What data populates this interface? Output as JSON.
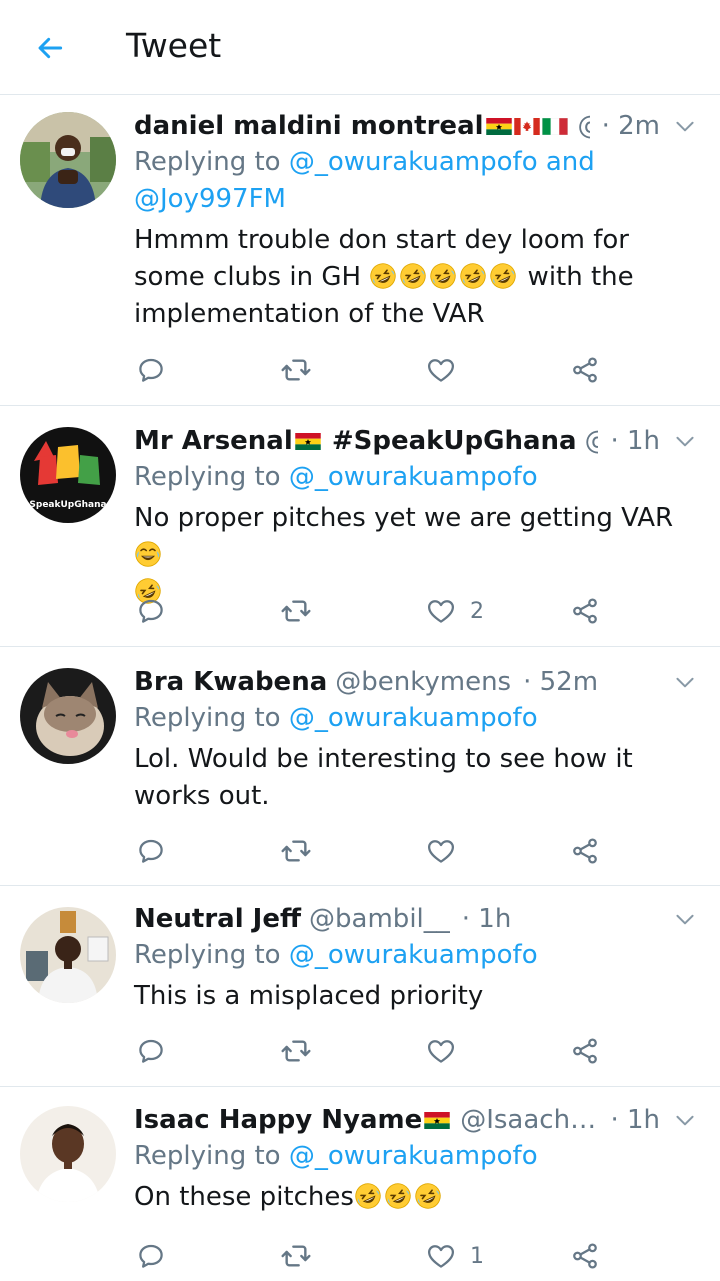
{
  "header": {
    "title": "Tweet"
  },
  "colors": {
    "accent": "#1da1f2",
    "secondary": "#657786",
    "text": "#14171a"
  },
  "tweets": [
    {
      "name": "daniel maldini montreal",
      "flags": [
        "ghana-flag",
        "canada-flag",
        "italy-flag"
      ],
      "handle": "@...",
      "time": "· 2m",
      "reply_prefix": "Replying to ",
      "reply_mentions": "@_owurakuampofo and @Joy997FM",
      "text_a": "Hmmm trouble don start dey loom for some clubs in GH ",
      "text_b": " with the implementation of the VAR",
      "like_count": ""
    },
    {
      "name": "Mr Arsenal",
      "name_suffix": " #SpeakUpGhana",
      "flags": [
        "ghana-flag"
      ],
      "handle": "@mi...",
      "time": "· 1h",
      "avatar_text": "SpeakUpGhana",
      "reply_prefix": "Replying to ",
      "reply_mentions": "@_owurakuampofo",
      "text_a": "No proper pitches yet we are getting VAR ",
      "like_count": "2"
    },
    {
      "name": "Bra Kwabena",
      "handle": "@benkymens",
      "time": "· 52m",
      "reply_prefix": "Replying to ",
      "reply_mentions": "@_owurakuampofo",
      "text_a": "Lol. Would be interesting to see how it works out.",
      "like_count": ""
    },
    {
      "name": "Neutral Jeff",
      "handle": "@bambil__",
      "time": "· 1h",
      "reply_prefix": "Replying to ",
      "reply_mentions": "@_owurakuampofo",
      "text_a": "This is a misplaced priority",
      "like_count": ""
    },
    {
      "name": "Isaac Happy Nyame",
      "flags": [
        "ghana-flag"
      ],
      "handle": "@Isaachappy...",
      "time": "· 1h",
      "reply_prefix": "Replying to ",
      "reply_mentions": "@_owurakuampofo",
      "text_a": "On these pitches",
      "like_count": "1"
    }
  ]
}
